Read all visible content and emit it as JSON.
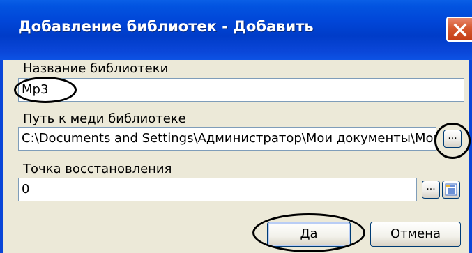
{
  "dialog": {
    "title": "Добавление библиотек - Добавить"
  },
  "fields": {
    "name_label": "Название библиотеки",
    "name_value": "Mp3",
    "path_label": "Путь к меди библиотеке",
    "path_value": "C:\\Documents and Settings\\Администратор\\Мои документы\\Мои",
    "restore_label": "Точка восстановления",
    "restore_value": "0"
  },
  "buttons": {
    "browse": "...",
    "ok": "Да",
    "cancel": "Отмена"
  },
  "icons": [
    "close-icon",
    "restore-point-list-icon"
  ]
}
